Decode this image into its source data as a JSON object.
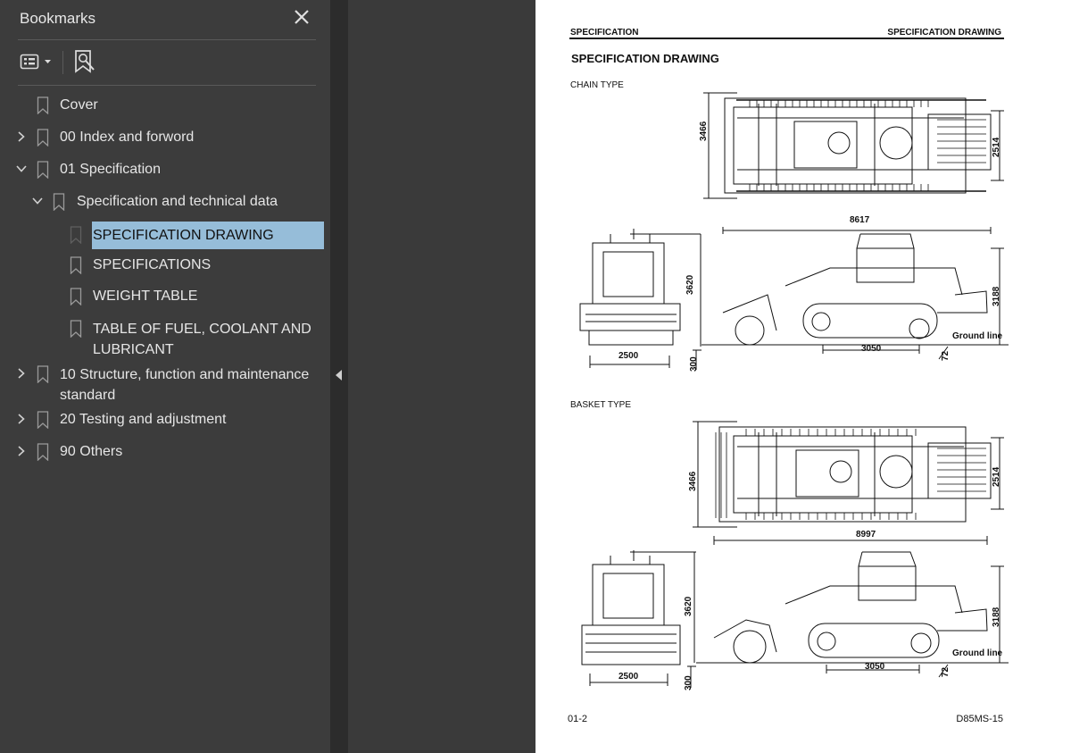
{
  "sidebar": {
    "title": "Bookmarks",
    "items": [
      {
        "label": "Cover"
      },
      {
        "label": "00 Index and forword"
      },
      {
        "label": "01 Specification"
      },
      {
        "label": "Specification and technical data"
      },
      {
        "label": "SPECIFICATION DRAWING"
      },
      {
        "label": "SPECIFICATIONS"
      },
      {
        "label": "WEIGHT TABLE"
      },
      {
        "label": "TABLE OF FUEL, COOLANT AND LUBRICANT"
      },
      {
        "label": "10 Structure, function and maintenance standard"
      },
      {
        "label": "20 Testing and adjustment"
      },
      {
        "label": "90 Others"
      }
    ]
  },
  "page": {
    "header_left": "SPECIFICATION",
    "header_right": "SPECIFICATION DRAWING",
    "title": "SPECIFICATION DRAWING",
    "chain": {
      "label": "CHAIN TYPE",
      "top_width": "3466",
      "top_track": "2514",
      "length": "8617",
      "height": "3620",
      "cab_height": "3188",
      "track_gauge": "2500",
      "wheelbase": "3050",
      "ground_offset": "300",
      "grouser": "72",
      "ground_line": "Ground line"
    },
    "basket": {
      "label": "BASKET TYPE",
      "top_width": "3466",
      "top_track": "2514",
      "length": "8997",
      "height": "3620",
      "cab_height": "3188",
      "track_gauge": "2500",
      "wheelbase": "3050",
      "ground_offset": "300",
      "grouser": "72",
      "ground_line": "Ground line"
    },
    "footer_left": "01-2",
    "footer_right": "D85MS-15"
  }
}
